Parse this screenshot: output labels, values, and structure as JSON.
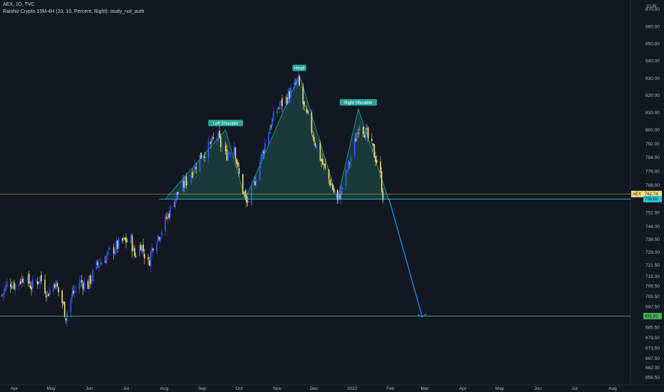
{
  "header": {
    "symbol_line": "AEX, 1D, TVC",
    "indicator_line": "Raishiz Crypto 15M-4H (20, 10, Percent, Right): study_not_auth"
  },
  "currency": "EUR",
  "colors": {
    "background": "#131722",
    "up_candle": "#2962ff",
    "down_candle": "#f5e07a",
    "pattern_line": "#26a69a",
    "pattern_fill": "#1c3f3f",
    "neckline": "#26c6da",
    "target_line": "#4caf50",
    "projection_arrow": "#2196f3",
    "price_line": "#f5e07a"
  },
  "chart_data": {
    "type": "candlestick",
    "symbol": "AEX",
    "interval": "1D",
    "source": "TVC",
    "y_axis": {
      "ticks": [
        870.0,
        860.0,
        850.0,
        840.0,
        830.0,
        820.0,
        810.0,
        800.0,
        792.0,
        784.0,
        776.0,
        768.0,
        760.0,
        752.0,
        744.0,
        736.5,
        729.0,
        721.5,
        715.0,
        709.5,
        703.5,
        697.5,
        691.5,
        685.5,
        679.5,
        673.5,
        667.5,
        662.0,
        656.5
      ],
      "tick_labels": [
        "870.00",
        "860.00",
        "850.00",
        "840.00",
        "830.00",
        "820.00",
        "810.00",
        "800.00",
        "792.00",
        "784.00",
        "776.00",
        "768.00",
        "760.00",
        "752.00",
        "744.00",
        "736.50",
        "729.00",
        "721.50",
        "715.00",
        "709.50",
        "703.50",
        "697.50",
        "691.50",
        "685.50",
        "679.50",
        "673.50",
        "667.50",
        "662.00",
        "656.50"
      ],
      "range": [
        652.0,
        872.0
      ]
    },
    "x_axis": {
      "labels": [
        "Apr",
        "May",
        "Jun",
        "Jul",
        "Aug",
        "Sep",
        "Oct",
        "Nov",
        "Dec",
        "2022",
        "Feb",
        "Mar",
        "Apr",
        "May",
        "Jun",
        "Jul",
        "Aug"
      ],
      "dates": [
        "2021-04-01",
        "2021-05-01",
        "2021-06-01",
        "2021-07-01",
        "2021-08-01",
        "2021-09-01",
        "2021-10-01",
        "2021-11-01",
        "2021-12-01",
        "2022-01-01",
        "2022-02-01",
        "2022-03-01",
        "2022-04-01",
        "2022-05-01",
        "2022-06-01",
        "2022-07-01",
        "2022-08-01"
      ]
    },
    "price_path": [
      [
        "2021-03-22",
        704
      ],
      [
        "2021-03-27",
        712
      ],
      [
        "2021-04-02",
        710
      ],
      [
        "2021-04-09",
        715
      ],
      [
        "2021-04-15",
        709
      ],
      [
        "2021-04-22",
        714
      ],
      [
        "2021-04-28",
        705
      ],
      [
        "2021-05-04",
        712
      ],
      [
        "2021-05-10",
        700
      ],
      [
        "2021-05-13",
        692
      ],
      [
        "2021-05-18",
        704
      ],
      [
        "2021-05-24",
        712
      ],
      [
        "2021-05-31",
        710
      ],
      [
        "2021-06-07",
        721
      ],
      [
        "2021-06-14",
        726
      ],
      [
        "2021-06-21",
        731
      ],
      [
        "2021-06-28",
        735
      ],
      [
        "2021-07-05",
        736
      ],
      [
        "2021-07-08",
        727
      ],
      [
        "2021-07-13",
        734
      ],
      [
        "2021-07-19",
        722
      ],
      [
        "2021-07-23",
        734
      ],
      [
        "2021-07-30",
        742
      ],
      [
        "2021-08-05",
        752
      ],
      [
        "2021-08-11",
        762
      ],
      [
        "2021-08-17",
        768
      ],
      [
        "2021-08-23",
        775
      ],
      [
        "2021-08-30",
        784
      ],
      [
        "2021-09-06",
        790
      ],
      [
        "2021-09-13",
        796
      ],
      [
        "2021-09-20",
        785
      ],
      [
        "2021-09-27",
        792
      ],
      [
        "2021-09-30",
        776
      ],
      [
        "2021-10-04",
        765
      ],
      [
        "2021-10-07",
        757
      ],
      [
        "2021-10-12",
        766
      ],
      [
        "2021-10-19",
        784
      ],
      [
        "2021-10-25",
        800
      ],
      [
        "2021-11-01",
        812
      ],
      [
        "2021-11-08",
        818
      ],
      [
        "2021-11-15",
        825
      ],
      [
        "2021-11-18",
        828
      ],
      [
        "2021-11-23",
        812
      ],
      [
        "2021-11-29",
        800
      ],
      [
        "2021-12-03",
        790
      ],
      [
        "2021-12-09",
        778
      ],
      [
        "2021-12-15",
        768
      ],
      [
        "2021-12-20",
        758
      ],
      [
        "2021-12-27",
        774
      ],
      [
        "2022-01-03",
        792
      ],
      [
        "2022-01-07",
        805
      ],
      [
        "2022-01-12",
        798
      ],
      [
        "2022-01-18",
        788
      ],
      [
        "2022-01-23",
        778
      ],
      [
        "2022-01-26",
        762
      ]
    ],
    "pattern": {
      "name": "head-and-shoulders",
      "labels": [
        "Left Shoulder",
        "Head",
        "Right Shoulder"
      ],
      "points": [
        [
          "2021-08-02",
          760
        ],
        [
          "2021-09-20",
          800
        ],
        [
          "2021-10-06",
          760
        ],
        [
          "2021-11-19",
          832
        ],
        [
          "2021-12-20",
          760
        ],
        [
          "2022-01-06",
          812
        ],
        [
          "2022-01-31",
          759
        ]
      ],
      "neckline": {
        "value": 759.8,
        "from": "2021-07-28",
        "to": "2022-09-01"
      },
      "projection": {
        "from": [
          "2022-01-31",
          759.8
        ],
        "to": [
          "2022-02-27",
          691.5
        ]
      },
      "target": 691.92
    },
    "price_labels": [
      {
        "text": "AEX",
        "value": "762.74",
        "sub": "03:26:52",
        "price": 762.74
      },
      {
        "text": "",
        "value": "759.83",
        "price": 759.83
      },
      {
        "text": "",
        "value": "691.92",
        "price": 691.92
      }
    ]
  }
}
